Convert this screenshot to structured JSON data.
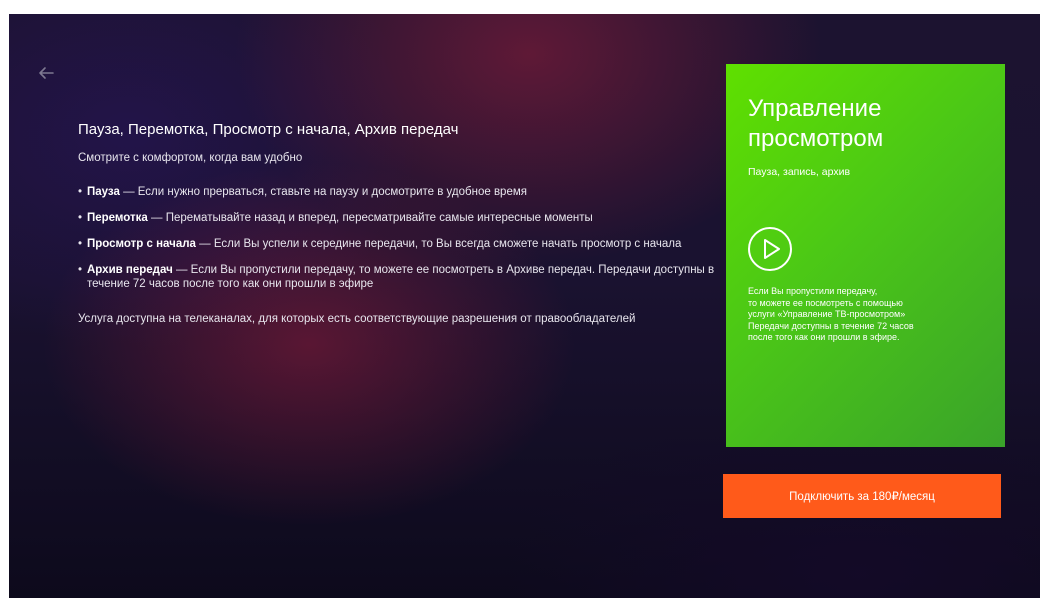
{
  "header": {
    "back_icon": "arrow-left-icon"
  },
  "info": {
    "title": "Пауза, Перемотка, Просмотр с начала, Архив передач",
    "subtitle": "Смотрите с комфортом, когда вам удобно",
    "features": [
      {
        "bullet": "•",
        "name": "Пауза",
        "text": " — Если нужно прерваться, ставьте на паузу и досмотрите в удобное время"
      },
      {
        "bullet": "•",
        "name": "Перемотка",
        "text": " — Перематывайте назад и вперед, пересматривайте самые интересные моменты"
      },
      {
        "bullet": "•",
        "name": "Просмотр с начала",
        "text": " — Если Вы успели к середине передачи, то Вы всегда сможете начать просмотр с начала"
      },
      {
        "bullet": "•",
        "name": "Архив передач",
        "text": " — Если Вы пропустили передачу, то можете ее посмотреть в Архиве передач. Передачи доступны в течение 72 часов после того как они прошли в эфире"
      }
    ],
    "note": "Услуга доступна на телеканалах, для которых есть соответствующие разрешения от правообладателей"
  },
  "card": {
    "title": "Управление просмотром",
    "subtitle": "Пауза, запись, архив",
    "icon": "play-circle-icon",
    "description": "Если Вы пропустили передачу,\nто можете ее посмотреть с помощью\nуслуги «Управление ТВ-просмотром»\nПередачи доступны в течение 72 часов\nпосле того как они прошли в эфире.",
    "color": "#52cc0f"
  },
  "cta": {
    "label": "Подключить за 180₽/месяц",
    "color": "#ff5a1a"
  }
}
